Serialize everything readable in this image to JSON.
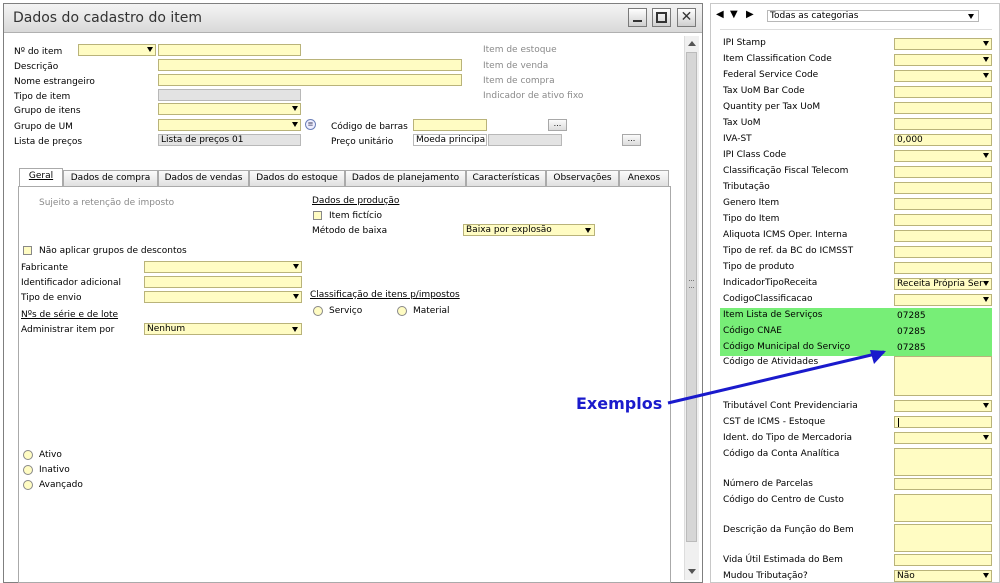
{
  "window": {
    "title": "Dados do cadastro do item"
  },
  "header": {
    "item_no_label": "Nº do item",
    "descricao_label": "Descrição",
    "nome_estrangeiro_label": "Nome estrangeiro",
    "tipo_item_label": "Tipo de item",
    "grupo_itens_label": "Grupo de itens",
    "grupo_um_label": "Grupo de UM",
    "lista_precos_label": "Lista de preços",
    "lista_precos_value": "Lista de preços 01",
    "codigo_barras_label": "Código de barras",
    "preco_unitario_label": "Preço unitário",
    "moeda_value": "Moeda principal",
    "browse": "...",
    "flags": [
      "Item de estoque",
      "Item de venda",
      "Item de compra",
      "Indicador de ativo fixo"
    ]
  },
  "tabs": [
    "Geral",
    "Dados de compra",
    "Dados de vendas",
    "Dados do estoque",
    "Dados de planejamento",
    "Características",
    "Observações",
    "Anexos"
  ],
  "geral": {
    "sujeito": "Sujeito a retenção de imposto",
    "dados_producao": "Dados de produção",
    "item_ficticio": "Item fictício",
    "metodo_baixa_label": "Método de baixa",
    "metodo_baixa_value": "Baixa por explosão",
    "nao_aplicar": "Não aplicar grupos de descontos",
    "fabricante": "Fabricante",
    "identificador": "Identificador adicional",
    "tipo_envio": "Tipo de envio",
    "classificacao": "Classificação de itens p/impostos",
    "servico": "Serviço",
    "material": "Material",
    "nos_serie": "Nºs de série e de lote",
    "administrar": "Administrar item por",
    "administrar_value": "Nenhum",
    "status": [
      "Ativo",
      "Inativo",
      "Avançado"
    ]
  },
  "right_pane": {
    "category": "Todas as categorias",
    "rows": [
      {
        "label": "IPI Stamp",
        "value": "",
        "dropdown": true
      },
      {
        "label": "Item Classification Code",
        "value": "",
        "dropdown": true
      },
      {
        "label": "Federal Service Code",
        "value": "",
        "dropdown": true
      },
      {
        "label": "Tax UoM Bar Code",
        "value": "",
        "dropdown": false
      },
      {
        "label": "Quantity per Tax UoM",
        "value": "",
        "dropdown": false
      },
      {
        "label": "Tax UoM",
        "value": "",
        "dropdown": false
      },
      {
        "label": "IVA-ST",
        "value": "0,000",
        "dropdown": false
      },
      {
        "label": "IPI Class Code",
        "value": "",
        "dropdown": true
      },
      {
        "label": "Classificação Fiscal Telecom",
        "value": "",
        "dropdown": false
      },
      {
        "label": "Tributação",
        "value": "",
        "dropdown": false
      },
      {
        "label": "Genero Item",
        "value": "",
        "dropdown": false
      },
      {
        "label": "Tipo do Item",
        "value": "",
        "dropdown": false
      },
      {
        "label": "Aliquota ICMS Oper. Interna",
        "value": "",
        "dropdown": false
      },
      {
        "label": "Tipo de ref. da BC do ICMSST",
        "value": "",
        "dropdown": false
      },
      {
        "label": "Tipo de produto",
        "value": "",
        "dropdown": false
      },
      {
        "label": "IndicadorTipoReceita",
        "value": "Receita Própria  Ser",
        "dropdown": true
      },
      {
        "label": "CodigoClassificacao",
        "value": "",
        "dropdown": true
      },
      {
        "label": "Item Lista de Serviços",
        "value": "07285",
        "dropdown": false
      },
      {
        "label": "Código CNAE",
        "value": "07285",
        "dropdown": false
      },
      {
        "label": "Código Municipal do Serviço",
        "value": "07285",
        "dropdown": false
      }
    ],
    "rows2": [
      {
        "label": "Código de Atividades",
        "value": ""
      },
      {
        "label": "Tributável Cont Previdenciaria",
        "value": ""
      },
      {
        "label": "CST  de ICMS - Estoque",
        "value": ""
      },
      {
        "label": "Ident. do Tipo de Mercadoria",
        "value": ""
      },
      {
        "label": "Código da Conta Analítica",
        "value": ""
      },
      {
        "label": "Número de Parcelas",
        "value": ""
      },
      {
        "label": "Código do Centro de Custo",
        "value": ""
      },
      {
        "label": "Descrição da Função do Bem",
        "value": ""
      },
      {
        "label": "Vida Útil Estimada do Bem",
        "value": ""
      },
      {
        "label": "Mudou Tributação?",
        "value": "Não"
      }
    ]
  },
  "annotation": {
    "text": "Exemplos",
    "color": "#1a1acc"
  }
}
